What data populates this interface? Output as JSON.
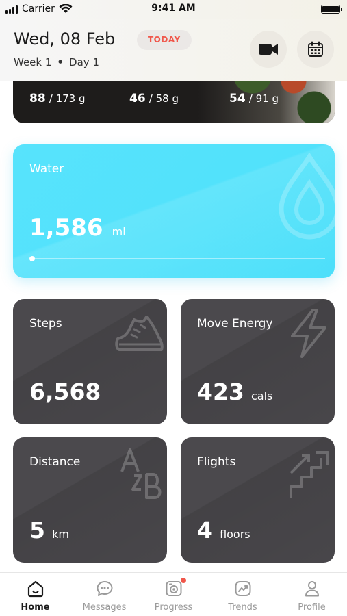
{
  "status_bar": {
    "carrier": "Carrier",
    "time": "9:41 AM"
  },
  "header": {
    "date": "Wed, 08 Feb",
    "badge": "TODAY",
    "week": "Week 1",
    "separator": "•",
    "day": "Day 1",
    "video_icon": "video-camera-icon",
    "calendar_icon": "calendar-icon"
  },
  "macros": {
    "protein": {
      "label": "Protein",
      "current": "88",
      "total": "/ 173 g"
    },
    "fat": {
      "label": "Fat",
      "current": "46",
      "total": "/ 58 g"
    },
    "carbs": {
      "label": "Carbs",
      "current": "54",
      "total": "/ 91 g"
    }
  },
  "water": {
    "title": "Water",
    "value": "1,586",
    "unit": "ml",
    "progress": 0.0,
    "icon": "water-drop-icon"
  },
  "stats": {
    "steps": {
      "title": "Steps",
      "value": "6,568",
      "unit": "",
      "icon": "shoe-icon"
    },
    "move_energy": {
      "title": "Move Energy",
      "value": "423",
      "unit": "cals",
      "icon": "lightning-icon"
    },
    "distance": {
      "title": "Distance",
      "value": "5",
      "unit": "km",
      "icon": "a-to-b-icon"
    },
    "flights": {
      "title": "Flights",
      "value": "4",
      "unit": "floors",
      "icon": "stairs-icon"
    }
  },
  "colors": {
    "water_card": "#52e2fb",
    "stat_card": "#4b494d",
    "accent_red": "#f0564a",
    "badge_bg": "#ebe8e6"
  },
  "tabs": [
    {
      "label": "Home",
      "icon": "home-icon",
      "active": true
    },
    {
      "label": "Messages",
      "icon": "chat-bubble-icon",
      "active": false
    },
    {
      "label": "Progress",
      "icon": "camera-progress-icon",
      "active": false,
      "notification": true
    },
    {
      "label": "Trends",
      "icon": "trend-chart-icon",
      "active": false
    },
    {
      "label": "Profile",
      "icon": "person-icon",
      "active": false
    }
  ]
}
